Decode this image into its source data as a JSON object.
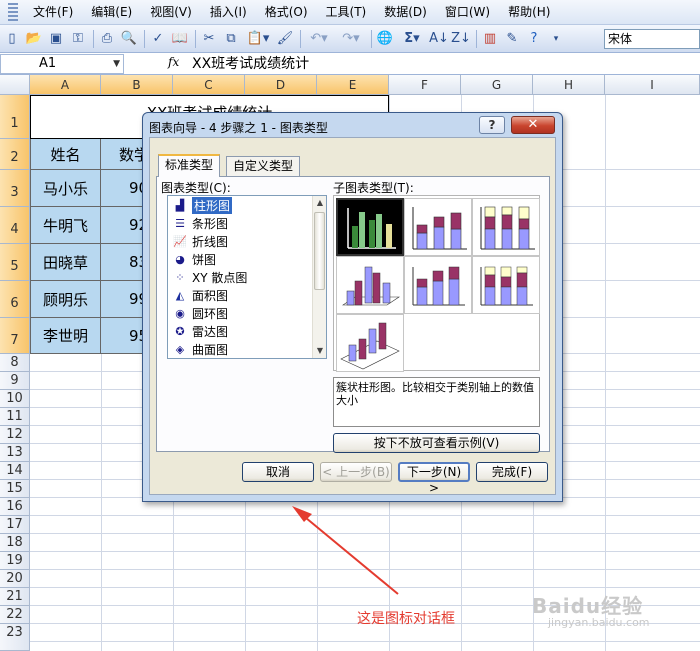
{
  "menu": {
    "items": [
      "文件(F)",
      "编辑(E)",
      "视图(V)",
      "插入(I)",
      "格式(O)",
      "工具(T)",
      "数据(D)",
      "窗口(W)",
      "帮助(H)"
    ]
  },
  "toolbar": {
    "font_name": "宋体",
    "icons": [
      "new-icon",
      "open-icon",
      "save-icon",
      "permission-icon",
      "print-icon",
      "print-preview-icon",
      "spelling-icon",
      "research-icon",
      "cut-icon",
      "copy-icon",
      "paste-icon",
      "format-painter-icon",
      "undo-icon",
      "redo-icon",
      "hyperlink-icon",
      "autosum-icon",
      "sort-ascending-icon",
      "sort-descending-icon",
      "chart-wizard-icon",
      "drawing-icon",
      "help-icon"
    ]
  },
  "formula_bar": {
    "name_box": "A1",
    "fx": "fx",
    "formula": "XX班考试成绩统计"
  },
  "sheet": {
    "columns": [
      "A",
      "B",
      "C",
      "D",
      "E",
      "F",
      "G",
      "H",
      "I"
    ],
    "rows": [
      "1",
      "2",
      "3",
      "4",
      "5",
      "6",
      "7",
      "8",
      "9",
      "10",
      "11",
      "12",
      "13",
      "14",
      "15",
      "16",
      "17",
      "18",
      "19",
      "20",
      "21",
      "22",
      "23"
    ],
    "title_visible": "XX班考试成绩统计",
    "header_a": "姓名",
    "header_b": "数学",
    "names": [
      "马小乐",
      "牛明飞",
      "田晓草",
      "顾明乐",
      "李世明"
    ],
    "scores_visible": [
      "90",
      "92",
      "83",
      "99",
      "95"
    ]
  },
  "dialog": {
    "title": "图表向导 - 4 步骤之 1 - 图表类型",
    "help_label": "?",
    "close_label": "✕",
    "tabs": [
      "标准类型",
      "自定义类型"
    ],
    "chart_type_label": "图表类型(C):",
    "subtype_label": "子图表类型(T):",
    "chart_types": [
      {
        "icon": "column-chart-icon",
        "label": "柱形图"
      },
      {
        "icon": "bar-chart-icon",
        "label": "条形图"
      },
      {
        "icon": "line-chart-icon",
        "label": "折线图"
      },
      {
        "icon": "pie-chart-icon",
        "label": "饼图"
      },
      {
        "icon": "scatter-chart-icon",
        "label": "XY 散点图"
      },
      {
        "icon": "area-chart-icon",
        "label": "面积图"
      },
      {
        "icon": "doughnut-chart-icon",
        "label": "圆环图"
      },
      {
        "icon": "radar-chart-icon",
        "label": "雷达图"
      },
      {
        "icon": "surface-chart-icon",
        "label": "曲面图"
      }
    ],
    "selected_type": "柱形图",
    "description": "簇状柱形图。比较相交于类别轴上的数值大小",
    "preview_button": "按下不放可查看示例(V)",
    "buttons": {
      "cancel": "取消",
      "back": "< 上一步(B)",
      "next": "下一步(N) >",
      "finish": "完成(F)"
    }
  },
  "annotation": "这是图标对话框",
  "watermark": {
    "main": "Baidu经验",
    "sub": "jingyan.baidu.com"
  },
  "colors": {
    "annotation": "#e43b2f",
    "cell_fill": "#b8d8f0",
    "selection_header": "#f8c46a",
    "selected_list": "#316ac5"
  }
}
